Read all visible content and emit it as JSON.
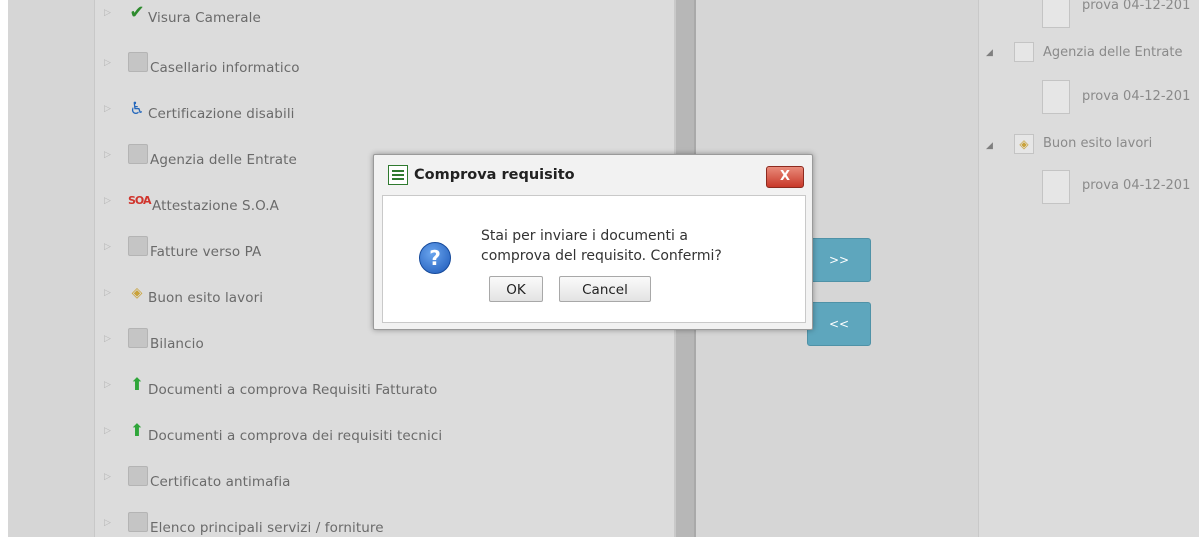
{
  "left_tree": {
    "items": [
      {
        "label": "Visura Camerale",
        "icon": "check-icon"
      },
      {
        "label": "Casellario informatico",
        "icon": "database-icon"
      },
      {
        "label": "Certificazione disabili",
        "icon": "wheelchair-icon"
      },
      {
        "label": "Agenzia delle Entrate",
        "icon": "agency-icon"
      },
      {
        "label": "Attestazione S.O.A",
        "icon": "soa-icon"
      },
      {
        "label": "Fatture verso PA",
        "icon": "invoice-icon"
      },
      {
        "label": "Buon esito lavori",
        "icon": "diamond-icon"
      },
      {
        "label": "Bilancio",
        "icon": "balance-icon"
      },
      {
        "label": "Documenti a comprova Requisiti Fatturato",
        "icon": "green-arrow-up-icon"
      },
      {
        "label": "Documenti a comprova dei requisiti tecnici",
        "icon": "green-arrow-up-icon"
      },
      {
        "label": "Certificato antimafia",
        "icon": "hand-icon"
      },
      {
        "label": "Elenco principali servizi / forniture",
        "icon": "list-icon"
      }
    ],
    "soa_icon_text": "SOA"
  },
  "move_buttons": {
    "forward": ">>",
    "back": "<<"
  },
  "right_tree": {
    "doc1": "prova 04-12-201",
    "group1": "Agenzia delle Entrate",
    "doc2": "prova 04-12-201",
    "group2": "Buon esito lavori",
    "doc3": "prova 04-12-201"
  },
  "dialog": {
    "title": "Comprova requisito",
    "close_label": "X",
    "message_line1": "Stai per inviare i documenti a",
    "message_line2": "comprova del requisito. Confermi?",
    "ok_label": "OK",
    "cancel_label": "Cancel",
    "question_glyph": "?"
  }
}
